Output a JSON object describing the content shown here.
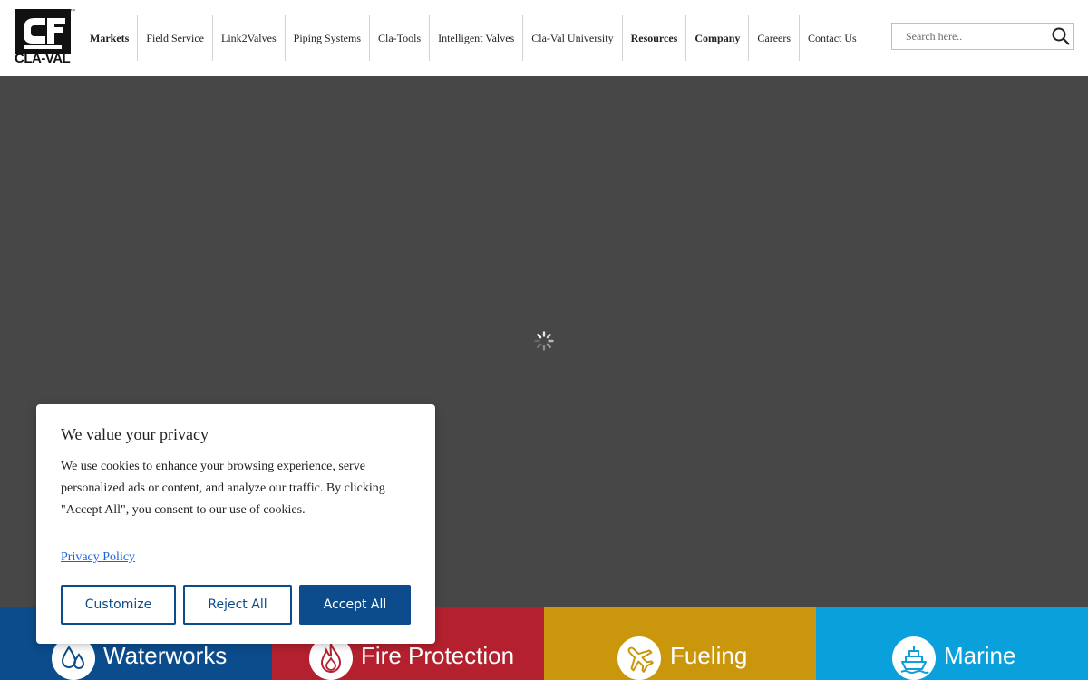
{
  "logo": {
    "text": "CLA-VAL",
    "tm": "™"
  },
  "nav": {
    "items": [
      {
        "label": "Markets",
        "bold": true
      },
      {
        "label": "Field Service",
        "bold": false
      },
      {
        "label": "Link2Valves",
        "bold": false
      },
      {
        "label": "Piping Systems",
        "bold": false
      },
      {
        "label": "Cla-Tools",
        "bold": false
      },
      {
        "label": "Intelligent Valves",
        "bold": false
      },
      {
        "label": "Cla-Val University",
        "bold": false
      },
      {
        "label": "Resources",
        "bold": true
      },
      {
        "label": "Company",
        "bold": true
      },
      {
        "label": "Careers",
        "bold": false
      },
      {
        "label": "Contact Us",
        "bold": false
      }
    ]
  },
  "search": {
    "placeholder": "Search here..",
    "value": "",
    "icon": "search-icon"
  },
  "hero": {
    "state": "loading",
    "icon": "spinner-icon",
    "background": "#474747"
  },
  "markets": [
    {
      "label": "Waterworks",
      "icon": "water-drops-icon",
      "color": "#0b4c8c"
    },
    {
      "label": "Fire Protection",
      "icon": "flame-icon",
      "color": "#b4202e"
    },
    {
      "label": "Fueling",
      "icon": "airplane-icon",
      "color": "#c9960c"
    },
    {
      "label": "Marine",
      "icon": "ship-icon",
      "color": "#0aa0dc"
    }
  ],
  "cookie": {
    "title": "We value your privacy",
    "text": "We use cookies to enhance your browsing experience, serve personalized ads or content, and analyze our traffic. By clicking \"Accept All\", you consent to our use of cookies.",
    "privacy_link": "Privacy Policy",
    "customize": "Customize",
    "reject": "Reject All",
    "accept": "Accept All",
    "accent": "#0c4c8c",
    "link_color": "#1863dc"
  }
}
